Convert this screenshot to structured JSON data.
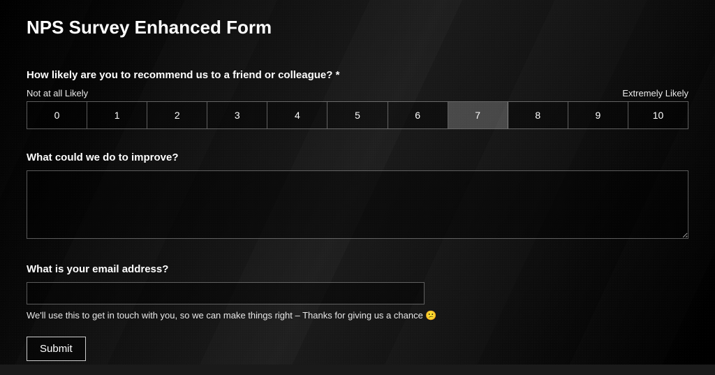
{
  "title": "NPS Survey Enhanced Form",
  "q1": {
    "label": "How likely are you to recommend us to a friend or colleague? *",
    "low_label": "Not at all Likely",
    "high_label": "Extremely Likely",
    "options": [
      "0",
      "1",
      "2",
      "3",
      "4",
      "5",
      "6",
      "7",
      "8",
      "9",
      "10"
    ],
    "selected": "7"
  },
  "q2": {
    "label": "What could we do to improve?",
    "value": ""
  },
  "q3": {
    "label": "What is your email address?",
    "value": "",
    "helper_text": "We'll use this to get in touch with you, so we can make things right – Thanks for giving us a chance ",
    "helper_emoji": "😕"
  },
  "submit_label": "Submit"
}
